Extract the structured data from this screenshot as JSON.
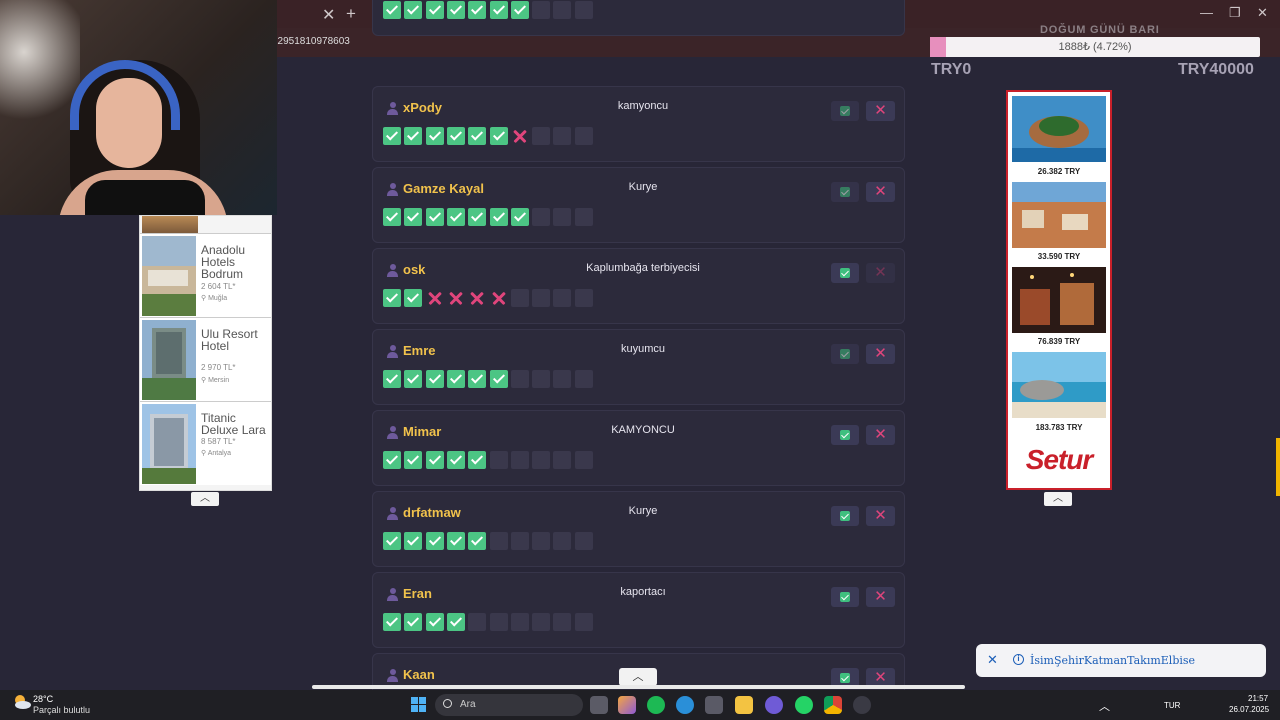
{
  "browser": {
    "url_fragment": "12951810978603"
  },
  "donation_goal": {
    "title": "DOĞUM GÜNÜ BARI",
    "progress_text": "1888₺ (4.72%)",
    "progress_fraction": 0.0472,
    "min_label": "TRY0",
    "max_label": "TRY40000"
  },
  "hotel_ad": {
    "items": [
      {
        "name": "Anadolu Hotels Bodrum",
        "price": "2 604 TL*",
        "location": "Muğla"
      },
      {
        "name": "Ulu Resort Hotel",
        "price": "2 970 TL*",
        "location": "Mersin"
      },
      {
        "name": "Titanic Deluxe Lara",
        "price": "8 587 TL*",
        "location": "Antalya"
      }
    ]
  },
  "players": [
    {
      "name": "xPody",
      "job": "kamyoncu",
      "boxes": [
        "ok",
        "ok",
        "ok",
        "ok",
        "ok",
        "ok",
        "no",
        "empty",
        "empty",
        "empty"
      ]
    },
    {
      "name": "Gamze Kayal",
      "job": "Kurye",
      "boxes": [
        "ok",
        "ok",
        "ok",
        "ok",
        "ok",
        "ok",
        "ok",
        "empty",
        "empty",
        "empty"
      ]
    },
    {
      "name": "osk",
      "job": "Kaplumbağa terbiyecisi",
      "boxes": [
        "ok",
        "ok",
        "no",
        "no",
        "no",
        "no",
        "empty",
        "empty",
        "empty",
        "empty"
      ]
    },
    {
      "name": "Emre",
      "job": "kuyumcu",
      "boxes": [
        "ok",
        "ok",
        "ok",
        "ok",
        "ok",
        "ok",
        "empty",
        "empty",
        "empty",
        "empty"
      ]
    },
    {
      "name": "Mimar",
      "job": "KAMYONCU",
      "boxes": [
        "ok",
        "ok",
        "ok",
        "ok",
        "ok",
        "empty",
        "empty",
        "empty",
        "empty",
        "empty"
      ]
    },
    {
      "name": "drfatmaw",
      "job": "Kurye",
      "boxes": [
        "ok",
        "ok",
        "ok",
        "ok",
        "ok",
        "empty",
        "empty",
        "empty",
        "empty",
        "empty"
      ]
    },
    {
      "name": "Eran",
      "job": "kaportacı",
      "boxes": [
        "ok",
        "ok",
        "ok",
        "ok",
        "empty",
        "empty",
        "empty",
        "empty",
        "empty",
        "empty"
      ]
    },
    {
      "name": "Kaan",
      "job": "",
      "boxes": []
    }
  ],
  "top_partial_boxes": [
    "ok",
    "ok",
    "ok",
    "ok",
    "ok",
    "ok",
    "ok",
    "empty",
    "empty",
    "empty"
  ],
  "setur_ad": {
    "prices": [
      "26.382 TRY",
      "33.590 TRY",
      "76.839 TRY",
      "183.783 TRY"
    ],
    "logo": "Setur"
  },
  "toast": {
    "text": "İsimŞehirKatmanTakımElbise"
  },
  "taskbar": {
    "temperature": "28°C",
    "weather": "Parçalı bulutlu",
    "search_placeholder": "Ara",
    "language": "TUR",
    "time": "21:57",
    "date": "26.07.2025"
  },
  "colors": {
    "accent_name": "#f1c24c",
    "check_green": "#4cc584",
    "cross_pink": "#e0457c",
    "background": "#282637"
  }
}
